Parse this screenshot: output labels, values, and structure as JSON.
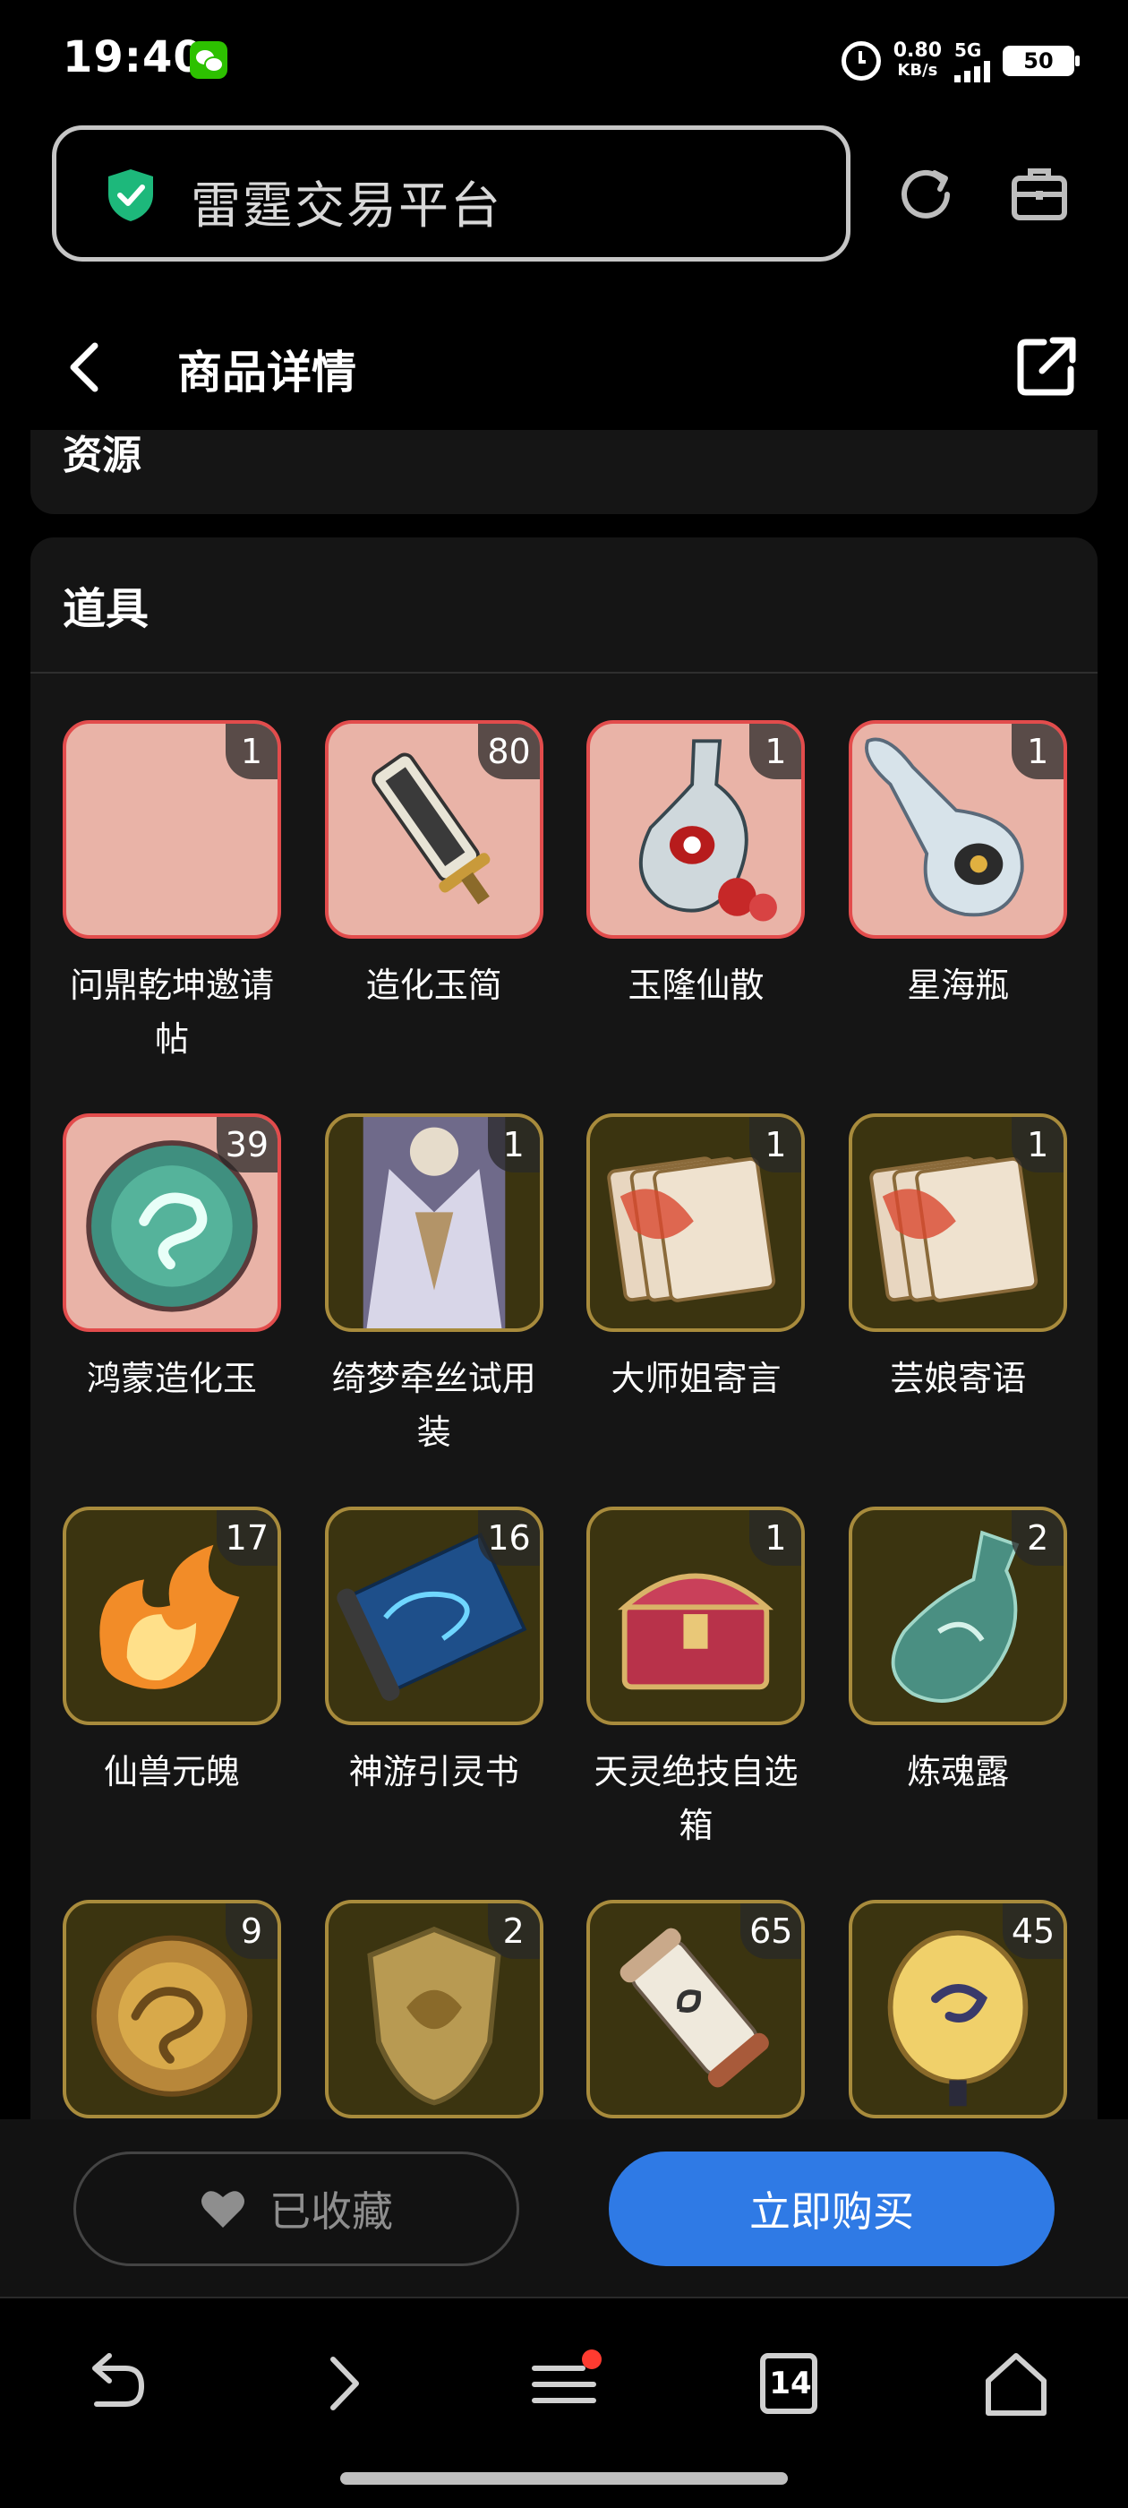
{
  "status_bar": {
    "time": "19:40",
    "speed_value": "0.80",
    "speed_unit": "KB/s",
    "network": "5G",
    "battery": "50"
  },
  "address_bar": {
    "site_name": "雷霆交易平台"
  },
  "header": {
    "title": "商品详情"
  },
  "sections": {
    "prev_label": "资源",
    "props_title": "道具"
  },
  "items": [
    {
      "name": "问鼎乾坤邀请帖",
      "count": "1",
      "rarity": "pink",
      "icon": "invitation"
    },
    {
      "name": "造化玉简",
      "count": "80",
      "rarity": "pink",
      "icon": "jade-slip"
    },
    {
      "name": "玉隆仙散",
      "count": "1",
      "rarity": "pink",
      "icon": "potion-flask"
    },
    {
      "name": "星海瓶",
      "count": "1",
      "rarity": "pink",
      "icon": "star-bottle"
    },
    {
      "name": "鸿蒙造化玉",
      "count": "39",
      "rarity": "pink",
      "icon": "jade-disc"
    },
    {
      "name": "绮梦牵丝试用装",
      "count": "1",
      "rarity": "gold",
      "icon": "costume"
    },
    {
      "name": "大师姐寄言",
      "count": "1",
      "rarity": "gold",
      "icon": "letters"
    },
    {
      "name": "芸娘寄语",
      "count": "1",
      "rarity": "gold",
      "icon": "letters"
    },
    {
      "name": "仙兽元魄",
      "count": "17",
      "rarity": "gold",
      "icon": "flame"
    },
    {
      "name": "神游引灵书",
      "count": "16",
      "rarity": "gold",
      "icon": "scroll"
    },
    {
      "name": "天灵绝技自选箱",
      "count": "1",
      "rarity": "gold",
      "icon": "chest"
    },
    {
      "name": "炼魂露",
      "count": "2",
      "rarity": "gold",
      "icon": "vial"
    },
    {
      "name": "",
      "count": "9",
      "rarity": "gold",
      "icon": "dragon-medal"
    },
    {
      "name": "",
      "count": "2",
      "rarity": "gold",
      "icon": "shield-emblem"
    },
    {
      "name": "",
      "count": "65",
      "rarity": "gold",
      "icon": "small-scroll"
    },
    {
      "name": "",
      "count": "45",
      "rarity": "gold",
      "icon": "lantern"
    }
  ],
  "actions": {
    "favorite_label": "已收藏",
    "buy_label": "立即购买"
  },
  "browser_nav": {
    "tab_count": "14"
  },
  "colors": {
    "accent": "#2f7ae5",
    "pink_tile": "#e9b3a7",
    "pink_border": "#e24c4c",
    "gold_tile": "#3b3410",
    "gold_border": "#a88b3c",
    "secure": "#1db87b",
    "notify_dot": "#ff3b30"
  }
}
